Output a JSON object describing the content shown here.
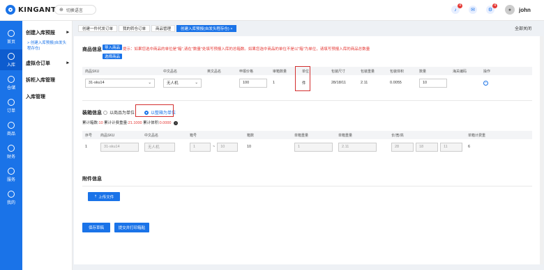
{
  "app": {
    "brand": "KINGANT",
    "lang_label": "切换语言",
    "user": "john",
    "badges": {
      "bell": "4",
      "chat": "",
      "gear": "4"
    }
  },
  "sidebar": {
    "items": [
      {
        "label": "首页",
        "icon": "dashboard-icon"
      },
      {
        "label": "入库",
        "icon": "inbound-icon",
        "active": true
      },
      {
        "label": "仓储",
        "icon": "warehouse-icon"
      },
      {
        "label": "订单",
        "icon": "order-icon"
      },
      {
        "label": "商品",
        "icon": "product-icon"
      },
      {
        "label": "财务",
        "icon": "finance-icon"
      },
      {
        "label": "服务",
        "icon": "service-icon"
      },
      {
        "label": "我的",
        "icon": "user-icon"
      }
    ]
  },
  "subnav": {
    "g1": "创建入库预报",
    "g1_sub": "> 创建入库预报(自发头程存仓)",
    "g2": "虚拟仓订单",
    "g3": "拆柜入库管理",
    "g4": "入库管理"
  },
  "tabs": [
    "创建一件代发订单",
    "我的转仓订单",
    "商品管理",
    "创建入库预报(自发头程存仓)"
  ],
  "close_all": "全部关闭",
  "goods": {
    "title": "商品信息",
    "import_btn": "导入商品",
    "select_btn": "选择商品",
    "hint": "提示：如果您选中商品的单位是\"箱\",请在\"数量\"处填写预报入库的总箱数。如果您选中商品的单位不是以\"箱\"为单位，请填写预报入库的商品总数量",
    "headers": [
      "商品SKU",
      "中文品名",
      "英文品名",
      "申报价格",
      "审箱数量",
      "单位",
      "包装尺寸",
      "包装重量",
      "包装体积",
      "数量",
      "海关编码",
      "操作"
    ],
    "row": {
      "sku": "31-sku14",
      "cn_name": "无人机",
      "en_name": "",
      "price": "100",
      "box_qty": "1",
      "unit": "件",
      "size": "28/18/11",
      "weight": "2.11",
      "volume": "0.0055",
      "qty": "10",
      "hs": ""
    }
  },
  "packing": {
    "title": "装箱信息",
    "opt1": "以商品为单位",
    "opt2": "以整箱为单位",
    "sum_label1": "累计箱数:",
    "sum_val1": "10",
    "sum_label2": " 累计计费重量:",
    "sum_val2": "21.1000",
    "sum_label3": " 累计体积:",
    "sum_val3": "0.0000",
    "headers": [
      "序号",
      "商品SKU",
      "中文品名",
      "箱号",
      "箱数",
      "单箱重量",
      "单箱重量",
      "长/宽/高",
      "单箱计费重"
    ],
    "row": {
      "idx": "1",
      "sku": "31-sku14",
      "name": "无人机",
      "box_from": "1",
      "sep": "~",
      "box_to": "10",
      "boxes": "10",
      "w1": "1",
      "w2": "2.11",
      "l": "28",
      "wd": "18",
      "h": "11",
      "bill": "6"
    }
  },
  "attach": {
    "title": "附件信息",
    "upload": "上传文件"
  },
  "actions": {
    "save": "保存草稿",
    "submit": "提交并打印箱贴"
  }
}
